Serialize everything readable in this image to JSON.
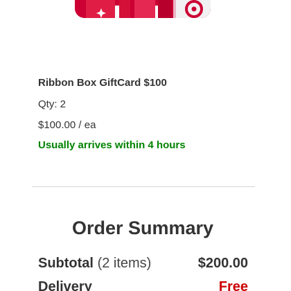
{
  "product": {
    "name": "Ribbon Box GiftCard $100",
    "qty": "Qty: 2",
    "price": "$100.00 / ea",
    "delivery_note": "Usually arrives within 4 hours",
    "image_icon": "gift-card-image"
  },
  "order_summary": {
    "title": "Order Summary",
    "subtotal_label": "Subtotal",
    "subtotal_items": "(2 items)",
    "subtotal_value": "$200.00",
    "delivery_label": "Delivery",
    "delivery_value": "Free"
  },
  "colors": {
    "brand_red": "#cc0033",
    "success_green": "#008300",
    "free_red": "#cc0000",
    "text": "#333333",
    "divider": "#d6d6d6"
  }
}
